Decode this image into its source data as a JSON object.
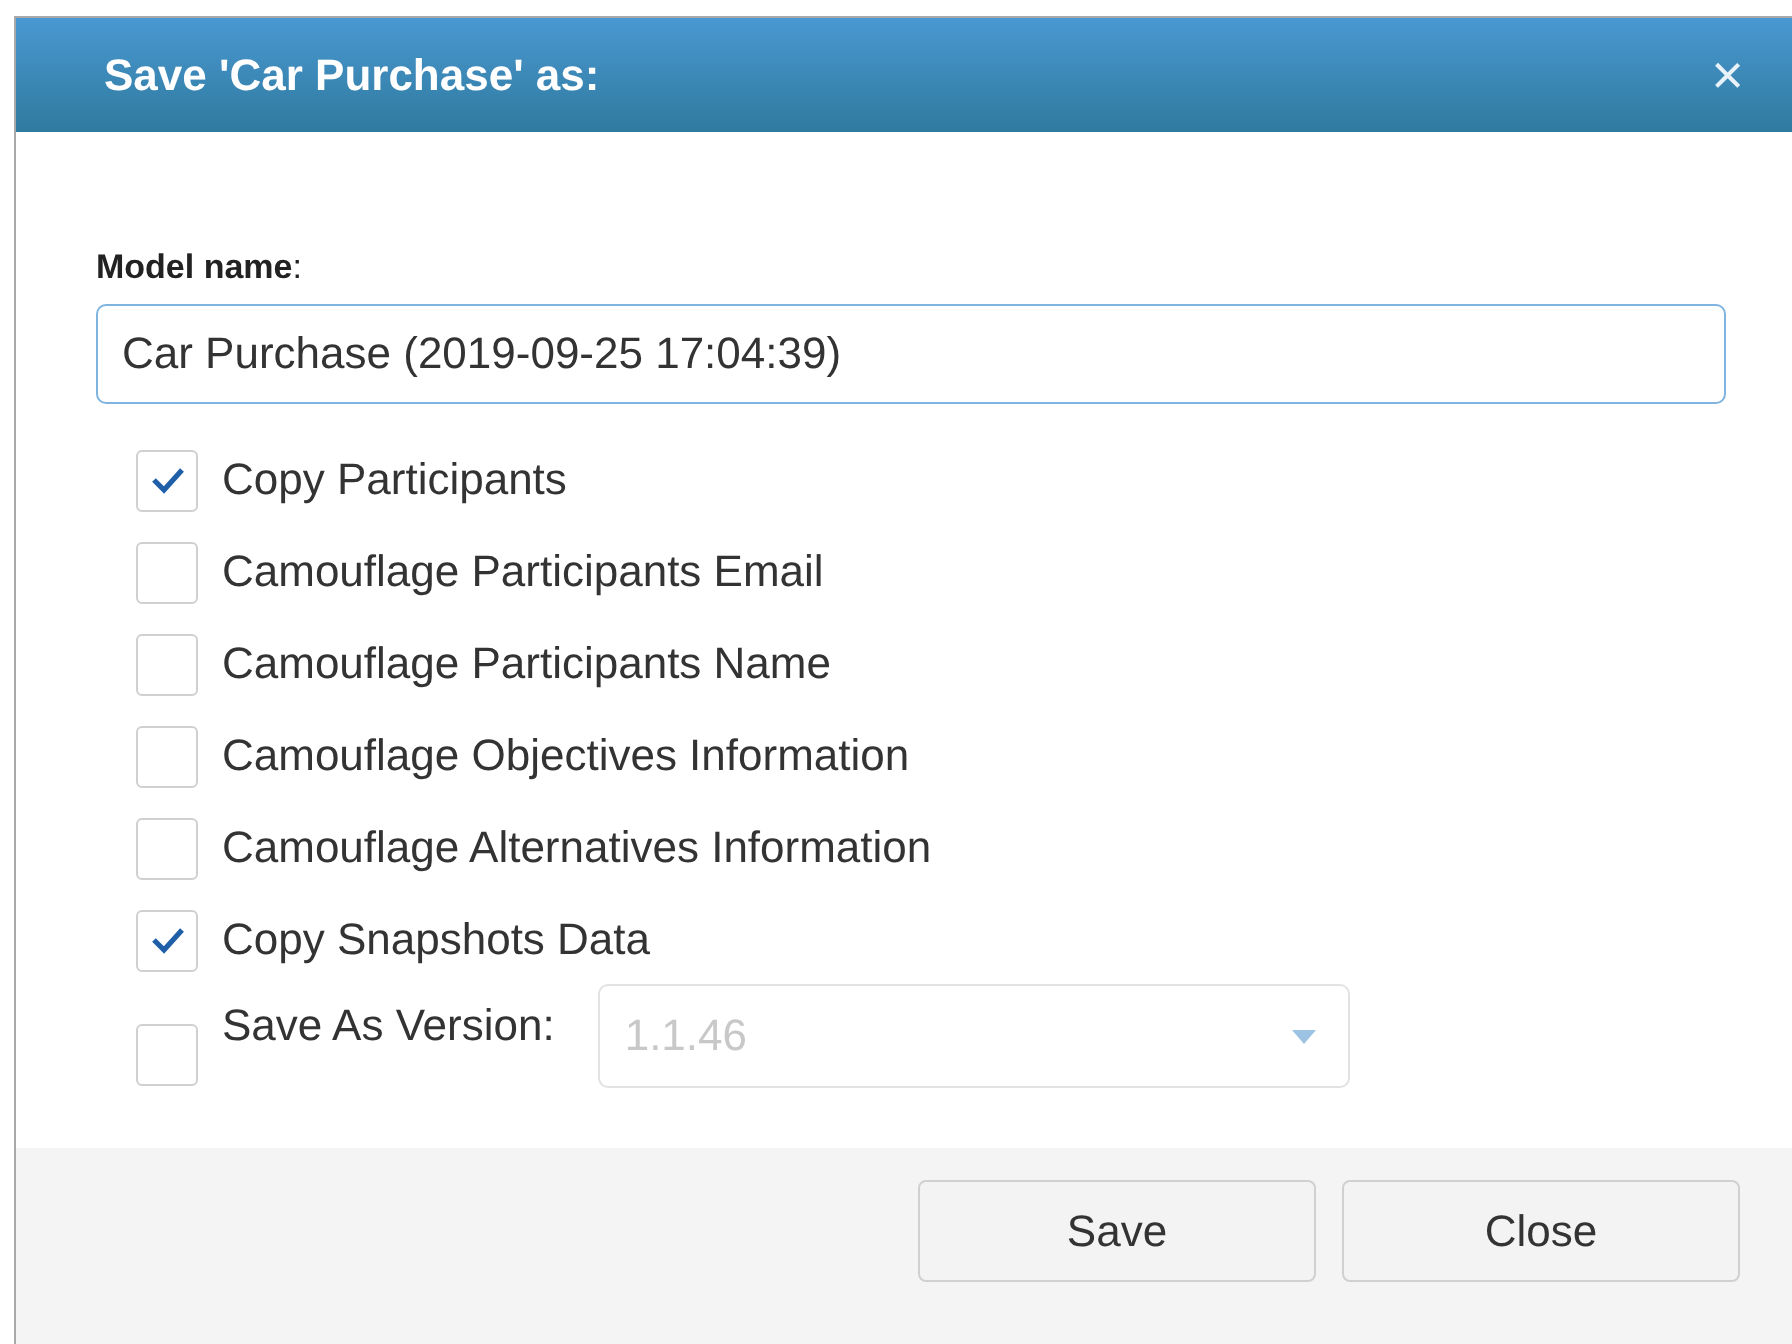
{
  "dialog": {
    "title": "Save 'Car Purchase' as:",
    "close": "×"
  },
  "model_name": {
    "label": "**Model name**:",
    "value": "Car Purchase (2019-09-25 17:04:39)"
  },
  "options": [
    {
      "kind": "checkbox",
      "label": "Copy Participants",
      "checked": true
    },
    {
      "kind": "checkbox",
      "label": "Camouflage Participants Email",
      "checked": false
    },
    {
      "kind": "checkbox",
      "label": "Camouflage Participants Name",
      "checked": false
    },
    {
      "kind": "checkbox",
      "label": "Camouflage Objectives Information",
      "checked": false
    },
    {
      "kind": "checkbox",
      "label": "Camouflage Alternatives Information",
      "checked": false
    },
    {
      "kind": "checkbox",
      "label": "Copy Snapshots Data",
      "checked": true
    },
    {
      "kind": "version",
      "label": "Save As Version:",
      "checked": false,
      "select": {
        "value": "1.1.46",
        "disabled": true
      }
    }
  ],
  "buttons": [
    "Save",
    "Close"
  ]
}
